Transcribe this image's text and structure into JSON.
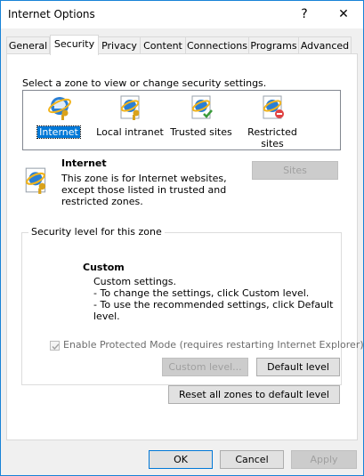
{
  "window": {
    "title": "Internet Options",
    "help_glyph": "?",
    "close_glyph": "✕"
  },
  "tabs": [
    {
      "label": "General"
    },
    {
      "label": "Security"
    },
    {
      "label": "Privacy"
    },
    {
      "label": "Content"
    },
    {
      "label": "Connections"
    },
    {
      "label": "Programs"
    },
    {
      "label": "Advanced"
    }
  ],
  "security": {
    "select_zone_label": "Select a zone to view or change security settings.",
    "zones": [
      {
        "label": "Internet",
        "selected": true
      },
      {
        "label": "Local intranet"
      },
      {
        "label": "Trusted sites"
      },
      {
        "label": "Restricted sites",
        "line1": "Restricted",
        "line2": "sites"
      }
    ],
    "zone_info": {
      "title": "Internet",
      "line1": "This zone is for Internet websites,",
      "line2": "except those listed in trusted and",
      "line3": "restricted zones."
    },
    "sites_button": "Sites",
    "level_group": {
      "legend": "Security level for this zone",
      "title": "Custom",
      "line1": "Custom settings.",
      "line2": "- To change the settings, click Custom level.",
      "line3": "- To use the recommended settings, click Default level."
    },
    "protected_mode": {
      "label": "Enable Protected Mode (requires restarting Internet Explorer)",
      "checked": true
    },
    "custom_level_button": "Custom level...",
    "default_level_button": "Default level",
    "reset_all_button": "Reset all zones to default level"
  },
  "footer": {
    "ok": "OK",
    "cancel": "Cancel",
    "apply": "Apply"
  },
  "colors": {
    "accent": "#0078d7",
    "window_border": "#1883d7",
    "dialog_bg": "#f0f0f0"
  }
}
